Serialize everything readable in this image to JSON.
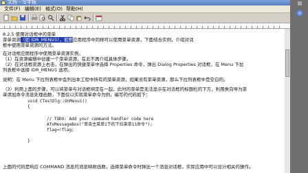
{
  "window": {
    "title": "文档 - 写字板"
  },
  "menu": [
    {
      "label": "文件(F)"
    },
    {
      "label": "编辑(E)"
    },
    {
      "label": "格式(O)"
    },
    {
      "label": "帮助(H)"
    }
  ],
  "colors": {
    "titlebar": "#5a7fc0",
    "selection": "#1f3bb0",
    "tray": "#6f6f6f"
  },
  "doc": {
    "heading": "8.2.5  使用对话框中的菜单",
    "p1_pre": "菜单资源",
    "p1_sel": "（如 IDR_MENU1），如图",
    "p1_post": "应用程序中同样可以使用菜单资源，下面结合实例，介绍对话",
    "p2": "框中使用菜单资源的方法。",
    "p3": "在对话框应用程序中使用菜单资源实例。",
    "p4": "（1）在资源编辑中创建一个菜单资源，在此不再介绍具体步骤。",
    "p5": "（2）在对话框资源上右击，在弹出的快捷菜单中选择 Properties 命令，弹出 Dialog Properties 对话框，在 Menu 下拉",
    "p6": "列表框中选择 IDR_MENU1 选项。",
    "p7": "说明：在 Menu 下拉列表框中会列出本工程中所有的菜单资源，如果没有菜单资源，那么下拉列表框中是空白的。",
    "p8": "（3）利用上面的步骤，可以将菜单与对话框绑定在一起，此时的菜单是无法显示在对话框的标题栏的下方，利用类向导为菜",
    "p9": "单添加命令消息处理函数，下面仅以实现菜单命令为例，编写的代码如下：",
    "code1": "void CTestDlg::OnMenu1()",
    "code2": "{",
    "code3": "// TODO: Add your command handler code here",
    "code4": "AfxMessageBox(\"单击主菜单1下的下拉菜单11命令\");",
    "code5": "flag=!flag;",
    "code6": "}",
    "p10": "上面的代码是响应 COMMAND 消息的消息映射函数，选择菜单命令时弹出一个消息对话框，实际应用中可以设计相关的操作。"
  },
  "icons": [
    "new-icon",
    "open-icon",
    "save-icon",
    "print-icon",
    "preview-icon",
    "find-icon",
    "cut-icon",
    "copy-icon",
    "paste-icon",
    "undo-icon",
    "date-icon"
  ]
}
